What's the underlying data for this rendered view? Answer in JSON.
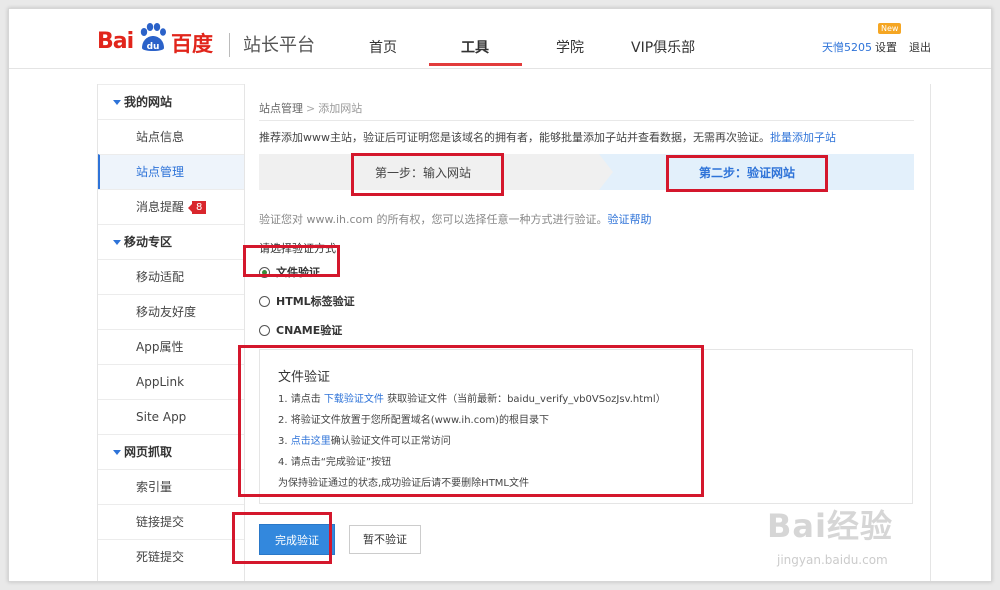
{
  "header": {
    "logo_left": "Bai",
    "logo_mid": "du",
    "logo_right": "百度",
    "site_title": "站长平台",
    "nav": [
      {
        "label": "首页"
      },
      {
        "label": "工具"
      },
      {
        "label": "学院"
      },
      {
        "label": "VIP俱乐部"
      }
    ],
    "active_nav": "工具",
    "user": "天憎5205",
    "new_badge": "New",
    "settings": "设置",
    "logout": "退出"
  },
  "sidebar": {
    "groups": [
      {
        "title": "我的网站",
        "items": [
          "站点信息",
          "站点管理",
          "消息提醒"
        ]
      },
      {
        "title": "移动专区",
        "items": [
          "移动适配",
          "移动友好度",
          "App属性",
          "AppLink",
          "Site App"
        ]
      },
      {
        "title": "网页抓取",
        "items": [
          "索引量",
          "链接提交",
          "死链提交"
        ]
      }
    ],
    "active_item": "站点管理",
    "message_count": "8"
  },
  "main": {
    "breadcrumb": {
      "parent": "站点管理",
      "sep": ">",
      "current": "添加网站"
    },
    "tip": "推荐添加www主站，验证后可证明您是该域名的拥有者，能够批量添加子站并查看数据，无需再次验证。",
    "tip_link": "批量添加子站",
    "step1": "第一步：输入网站",
    "step2": "第二步：验证网站",
    "verify_text": "验证您对 www.ih.com 的所有权，您可以选择任意一种方式进行验证。",
    "verify_help": "验证帮助",
    "choose_label": "请选择验证方式：",
    "methods": [
      "文件验证",
      "HTML标签验证",
      "CNAME验证"
    ],
    "selected_method": "文件验证",
    "instructions": {
      "title": "文件验证",
      "line1_prefix": "1. 请点击 ",
      "line1_link": "下载验证文件",
      "line1_suffix": " 获取验证文件（当前最新：baidu_verify_vb0VSozJsv.html）",
      "line2": "2. 将验证文件放置于您所配置域名(www.ih.com)的根目录下",
      "line3_prefix": "3. ",
      "line3_link": "点击这里",
      "line3_suffix": "确认验证文件可以正常访问",
      "line4": "4. 请点击“完成验证”按钮",
      "note": "为保持验证通过的状态,成功验证后请不要删除HTML文件"
    },
    "btn_done": "完成验证",
    "btn_skip": "暂不验证"
  },
  "watermark": {
    "text": "Bai经验",
    "url": "jingyan.baidu.com"
  },
  "colors": {
    "brand_red": "#e1251b",
    "link_blue": "#2e73d8",
    "annotation_red": "#d4172c",
    "primary_button": "#3388dd"
  }
}
